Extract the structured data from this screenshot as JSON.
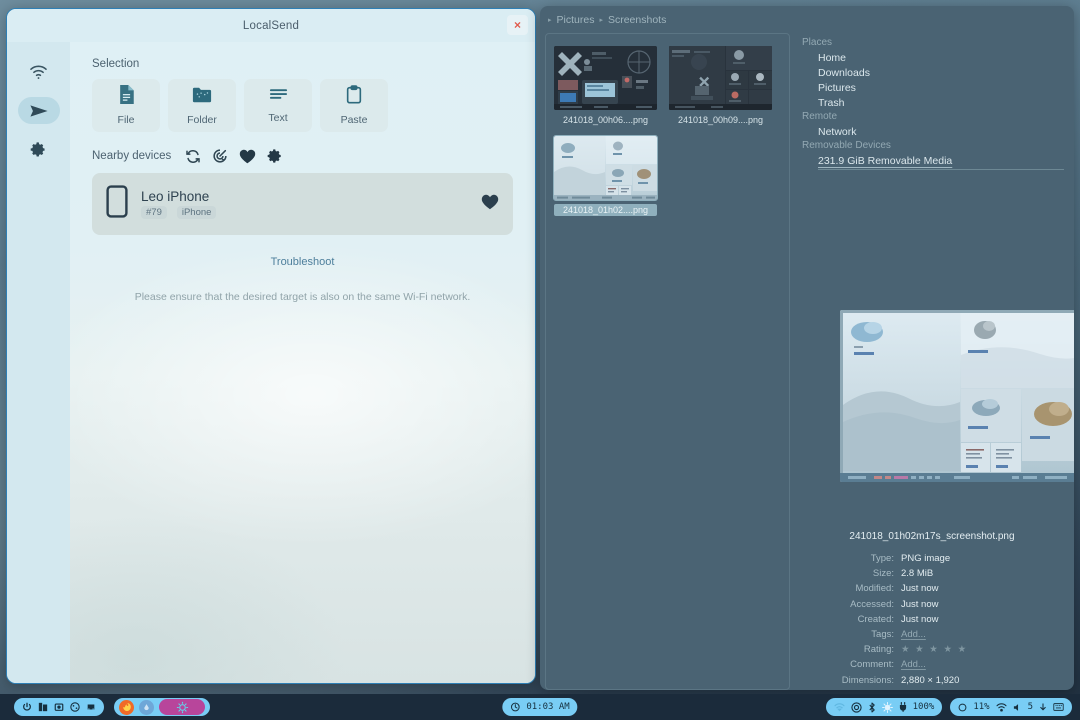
{
  "desktop": {
    "accent": "#79cdf5",
    "background": "#4a6373"
  },
  "localsend": {
    "title": "LocalSend",
    "close_label": "×",
    "rail": [
      {
        "name": "receive",
        "icon": "wifi-icon",
        "active": false
      },
      {
        "name": "send",
        "icon": "send-icon",
        "active": true
      },
      {
        "name": "settings",
        "icon": "gear-icon",
        "active": false
      }
    ],
    "selection": {
      "heading": "Selection",
      "buttons": [
        {
          "label": "File",
          "icon": "file-icon"
        },
        {
          "label": "Folder",
          "icon": "folder-icon"
        },
        {
          "label": "Text",
          "icon": "text-icon"
        },
        {
          "label": "Paste",
          "icon": "clipboard-icon"
        }
      ]
    },
    "nearby": {
      "heading": "Nearby devices",
      "actions": [
        {
          "name": "refresh",
          "icon": "refresh-icon"
        },
        {
          "name": "scan",
          "icon": "radar-scan-icon"
        },
        {
          "name": "favorites",
          "icon": "heart-icon"
        },
        {
          "name": "device-settings",
          "icon": "gear-icon"
        }
      ],
      "device": {
        "name": "Leo iPhone",
        "id": "#79",
        "model": "iPhone",
        "icon": "phone-icon",
        "favorite_icon": "heart-icon"
      }
    },
    "troubleshoot_label": "Troubleshoot",
    "hint": "Please ensure that the desired target is also on the same Wi-Fi network."
  },
  "filemanager": {
    "breadcrumb": [
      {
        "label": "Pictures"
      },
      {
        "label": "Screenshots"
      }
    ],
    "files": [
      {
        "label": "241018_00h06....png",
        "selected": false,
        "thumb": "dark-desktop"
      },
      {
        "label": "241018_00h09....png",
        "selected": false,
        "thumb": "dark-grid"
      },
      {
        "label": "241018_01h02....png",
        "selected": true,
        "thumb": "light-grid"
      }
    ],
    "sidebar": [
      {
        "heading": "Places",
        "items": [
          {
            "label": "Home"
          },
          {
            "label": "Downloads"
          },
          {
            "label": "Pictures"
          },
          {
            "label": "Trash"
          }
        ]
      },
      {
        "heading": "Remote",
        "items": [
          {
            "label": "Network"
          }
        ]
      },
      {
        "heading": "Removable Devices",
        "items": [
          {
            "label": "231.9 GiB Removable Media",
            "underlined": true
          }
        ]
      }
    ],
    "preview": {
      "filename": "241018_01h02m17s_screenshot.png",
      "properties": [
        {
          "key": "Type:",
          "value": "PNG image",
          "muted": false
        },
        {
          "key": "Size:",
          "value": "2.8 MiB",
          "muted": false
        },
        {
          "key": "Modified:",
          "value": "Just now",
          "muted": false
        },
        {
          "key": "Accessed:",
          "value": "Just now",
          "muted": false
        },
        {
          "key": "Created:",
          "value": "Just now",
          "muted": false
        },
        {
          "key": "Tags:",
          "value": "Add...",
          "muted": true
        },
        {
          "key": "Rating:",
          "value": "★ ★ ★ ★ ★",
          "muted": false,
          "stars": true
        },
        {
          "key": "Comment:",
          "value": "Add...",
          "muted": true
        },
        {
          "key": "Dimensions:",
          "value": "2,880 × 1,920",
          "muted": false
        }
      ]
    }
  },
  "taskbar": {
    "system_icons": [
      {
        "name": "power-icon"
      },
      {
        "name": "files-icon"
      },
      {
        "name": "screenshot-icon"
      },
      {
        "name": "palette-icon"
      },
      {
        "name": "game-icon"
      }
    ],
    "apps": [
      {
        "name": "firefox-app",
        "color": "#f06a28"
      },
      {
        "name": "water-app",
        "color": "#6ea7d8"
      },
      {
        "name": "active-app",
        "color": "#b8459b"
      }
    ],
    "clock": {
      "icon": "clock-icon",
      "time": "01:03 AM"
    },
    "tray_left": [
      {
        "name": "wifi-icon",
        "label": ""
      },
      {
        "name": "network-icon",
        "label": ""
      },
      {
        "name": "bluetooth-icon",
        "label": ""
      },
      {
        "name": "brightness-icon",
        "label": ""
      },
      {
        "name": "power-plug-icon",
        "label": "100%"
      }
    ],
    "tray_right": [
      {
        "name": "cpu-icon",
        "label": "11%"
      },
      {
        "name": "wifi-signal-icon",
        "label": ""
      },
      {
        "name": "volume-icon",
        "label": "5"
      },
      {
        "name": "download-icon",
        "label": ""
      },
      {
        "name": "keyboard-icon",
        "label": ""
      }
    ]
  }
}
